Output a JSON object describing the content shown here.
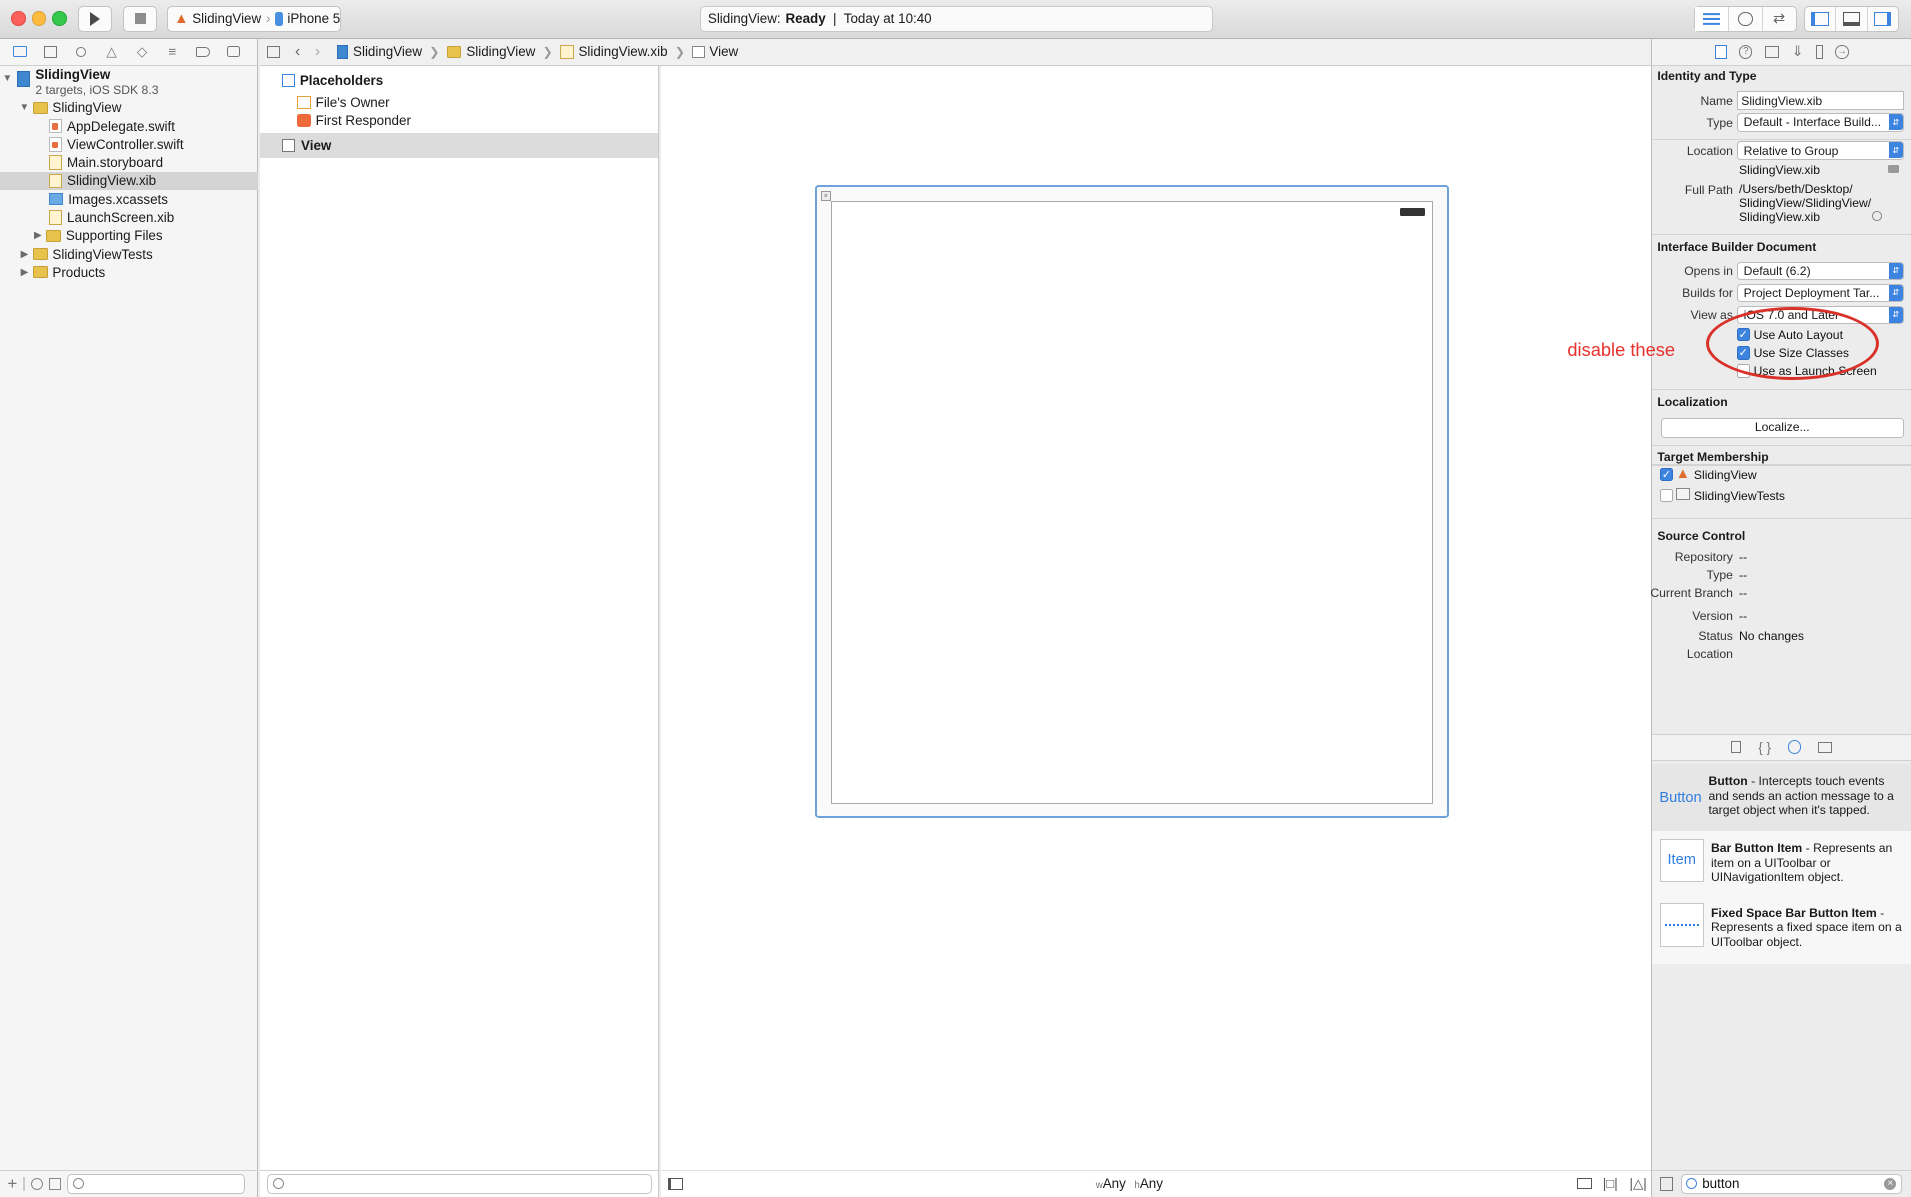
{
  "toolbar": {
    "scheme_name": "SlidingView",
    "scheme_device": "iPhone 5",
    "activity_project": "SlidingView:",
    "activity_status": "Ready",
    "activity_separator": "|",
    "activity_time": "Today at 10:40"
  },
  "navigator": {
    "project_name": "SlidingView",
    "project_subtitle": "2 targets, iOS SDK 8.3",
    "items": [
      {
        "label": "SlidingView",
        "kind": "folder"
      },
      {
        "label": "AppDelegate.swift",
        "kind": "swift"
      },
      {
        "label": "ViewController.swift",
        "kind": "swift"
      },
      {
        "label": "Main.storyboard",
        "kind": "xib"
      },
      {
        "label": "SlidingView.xib",
        "kind": "xib"
      },
      {
        "label": "Images.xcassets",
        "kind": "asset"
      },
      {
        "label": "LaunchScreen.xib",
        "kind": "xib"
      },
      {
        "label": "Supporting Files",
        "kind": "folder"
      },
      {
        "label": "SlidingViewTests",
        "kind": "folder"
      },
      {
        "label": "Products",
        "kind": "folder"
      }
    ]
  },
  "jumpbar": {
    "crumb1": "SlidingView",
    "crumb2": "SlidingView",
    "crumb3": "SlidingView.xib",
    "crumb4": "View"
  },
  "outline": {
    "placeholders": "Placeholders",
    "files_owner": "File's Owner",
    "first_responder": "First Responder",
    "view": "View"
  },
  "canvas": {
    "size_w_prefix": "w",
    "size_w_value": "Any",
    "size_h_prefix": "h",
    "size_h_value": "Any"
  },
  "inspector": {
    "identity_title": "Identity and Type",
    "name_label": "Name",
    "name_value": "SlidingView.xib",
    "type_label": "Type",
    "type_value": "Default - Interface Build...",
    "location_label": "Location",
    "location_value": "Relative to Group",
    "location_file": "SlidingView.xib",
    "fullpath_label": "Full Path",
    "fullpath_line1": "/Users/beth/Desktop/",
    "fullpath_line2": "SlidingView/SlidingView/",
    "fullpath_line3": "SlidingView.xib",
    "ibdoc_title": "Interface Builder Document",
    "opens_in_label": "Opens in",
    "opens_in_value": "Default (6.2)",
    "builds_for_label": "Builds for",
    "builds_for_value": "Project Deployment Tar...",
    "view_as_label": "View as",
    "view_as_value": "iOS 7.0 and Later",
    "use_auto_layout": "Use Auto Layout",
    "use_size_classes": "Use Size Classes",
    "use_launch_screen": "Use as Launch Screen",
    "localization_title": "Localization",
    "localize_button": "Localize...",
    "target_title": "Target Membership",
    "target1": "SlidingView",
    "target2": "SlidingViewTests",
    "source_title": "Source Control",
    "repository_label": "Repository",
    "repository_value": "--",
    "sc_type_label": "Type",
    "sc_type_value": "--",
    "branch_label": "Current Branch",
    "branch_value": "--",
    "version_label": "Version",
    "version_value": "--",
    "status_label": "Status",
    "status_value": "No changes",
    "sc_location_label": "Location"
  },
  "library": {
    "items": [
      {
        "icon_text": "Button",
        "title": "Button",
        "desc": " - Intercepts touch events and sends an action message to a target object when it's tapped."
      },
      {
        "icon_text": "Item",
        "title": "Bar Button Item",
        "desc": " - Represents an item on a UIToolbar or UINavigationItem object."
      },
      {
        "icon_text": "",
        "title": "Fixed Space Bar Button Item",
        "desc": " - Represents a fixed space item on a UIToolbar object."
      }
    ],
    "search_value": "button"
  },
  "annotation": {
    "text": "disable these",
    "color": "#e8312c"
  },
  "colors": {
    "accent": "#3d84e0",
    "selection": "#d4d4d4",
    "device_border": "#6ca3d9"
  }
}
